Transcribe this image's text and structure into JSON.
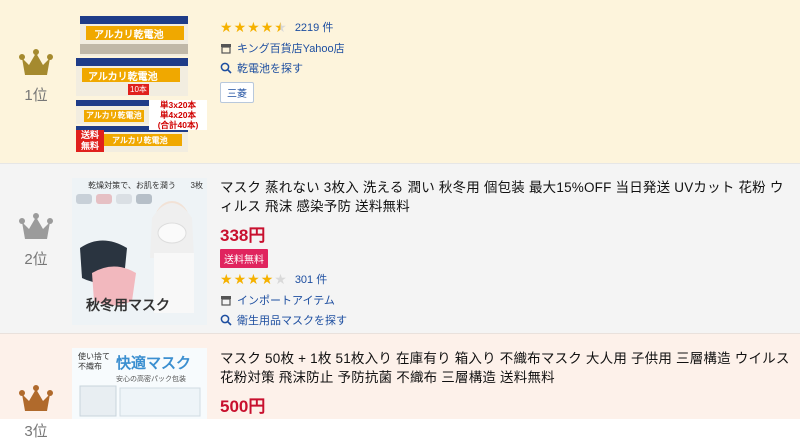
{
  "items": [
    {
      "rank_label": "1位",
      "rank_color": "#a58a2f",
      "rating": 4.5,
      "stars": "★★★★★",
      "review_count": "2219 件",
      "store": "キング百貨店Yahoo店",
      "search_link": "乾電池を探す",
      "brand_tag": "三菱",
      "thumb": {
        "label_a": "アルカリ乾電池",
        "label_b": "アルカリ乾電池",
        "label_c": "アルカリ乾電池",
        "label_d": "アルカリ乾電池",
        "pack_10": "10本",
        "note_1": "単3x20本",
        "note_2": "単4x20本",
        "note_3": "(合計40本)",
        "ship": "送料\n無料"
      }
    },
    {
      "rank_label": "2位",
      "rank_color": "#9b9b9b",
      "title": "マスク 蒸れない 3枚入 洗える 潤い 秋冬用 個包装 最大15%OFF 当日発送 UVカット 花粉 ウィルス 飛沫 感染予防 送料無料",
      "price": "338円",
      "shipping_badge": "送料無料",
      "rating": 4,
      "stars": "★★★★★",
      "review_count": "301 件",
      "store": "インポートアイテム",
      "search_link": "衛生用品マスクを探す",
      "thumb": {
        "top_text": "乾燥対策で、お肌を潤う",
        "count": "3枚",
        "bottom_text": "秋冬用マスク"
      }
    },
    {
      "rank_label": "3位",
      "rank_color": "#b06a2c",
      "title": "マスク 50枚 + 1枚 51枚入り 在庫有り 箱入り 不織布マスク 大人用 子供用 三層構造 ウイルス 花粉対策 飛沫防止 予防抗菌 不織布 三層構造 送料無料",
      "price": "500円",
      "thumb": {
        "label_left": "使い捨て\n不織布",
        "label_main": "快適マスク",
        "label_sub": "安心の高密パック包装"
      }
    }
  ],
  "colors": {
    "star_on": "#f5b100",
    "star_off": "#d9d9d9",
    "link": "#1d4ea0",
    "price": "#c8102e"
  }
}
